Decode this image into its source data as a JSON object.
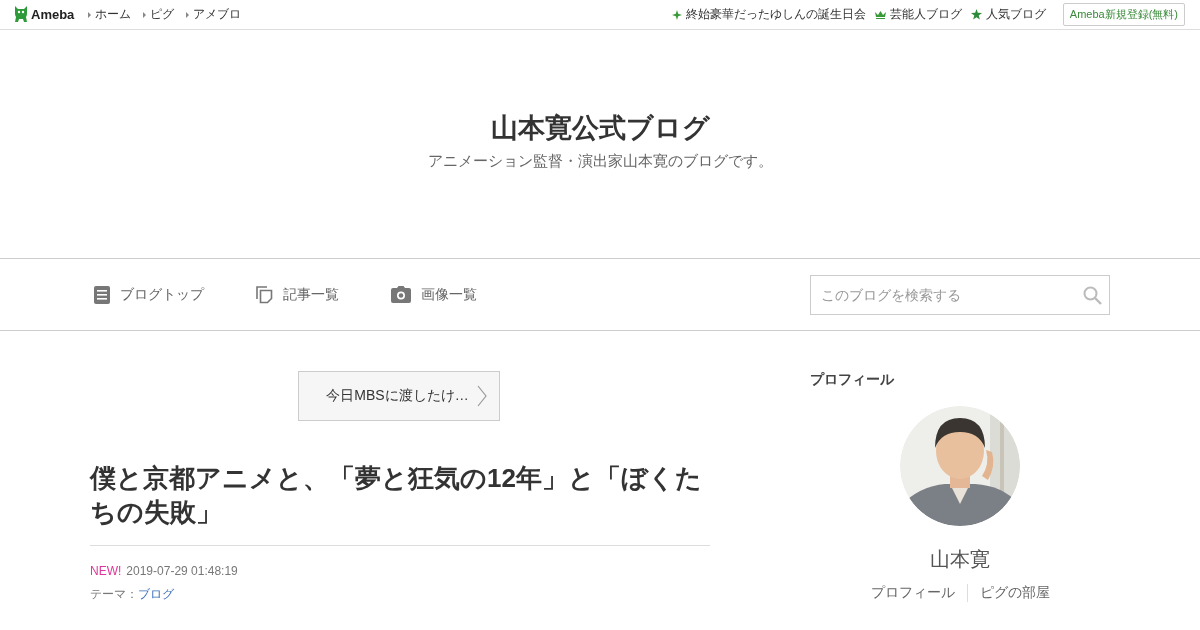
{
  "topbar": {
    "logo": "Ameba",
    "links": [
      "ホーム",
      "ピグ",
      "アメブロ"
    ],
    "right_links": [
      {
        "kind": "sparkle",
        "label": "終始豪華だったゆしんの誕生日会"
      },
      {
        "kind": "crown",
        "label": "芸能人ブログ"
      },
      {
        "kind": "star",
        "label": "人気ブログ"
      }
    ],
    "signup_button": "Ameba新規登録(無料)"
  },
  "header": {
    "title": "山本寛公式ブログ",
    "subtitle": "アニメーション監督・演出家山本寛のブログです。"
  },
  "nav": {
    "items": [
      {
        "kind": "document",
        "label": "ブログトップ"
      },
      {
        "kind": "pages",
        "label": "記事一覧"
      },
      {
        "kind": "camera",
        "label": "画像一覧"
      }
    ],
    "search": {
      "placeholder": "このブログを検索する"
    }
  },
  "entry": {
    "previous_link": "今日MBSに渡したけ…",
    "title": "僕と京都アニメと、「夢と狂気の12年」と「ぼくたちの失敗」",
    "new_badge": "NEW!",
    "date": "2019-07-29 01:48:19",
    "theme_label": "テーマ：",
    "theme": "ブログ"
  },
  "sidebar": {
    "heading": "プロフィール",
    "name": "山本寛",
    "links": [
      "プロフィール",
      "ピグの部屋"
    ]
  }
}
